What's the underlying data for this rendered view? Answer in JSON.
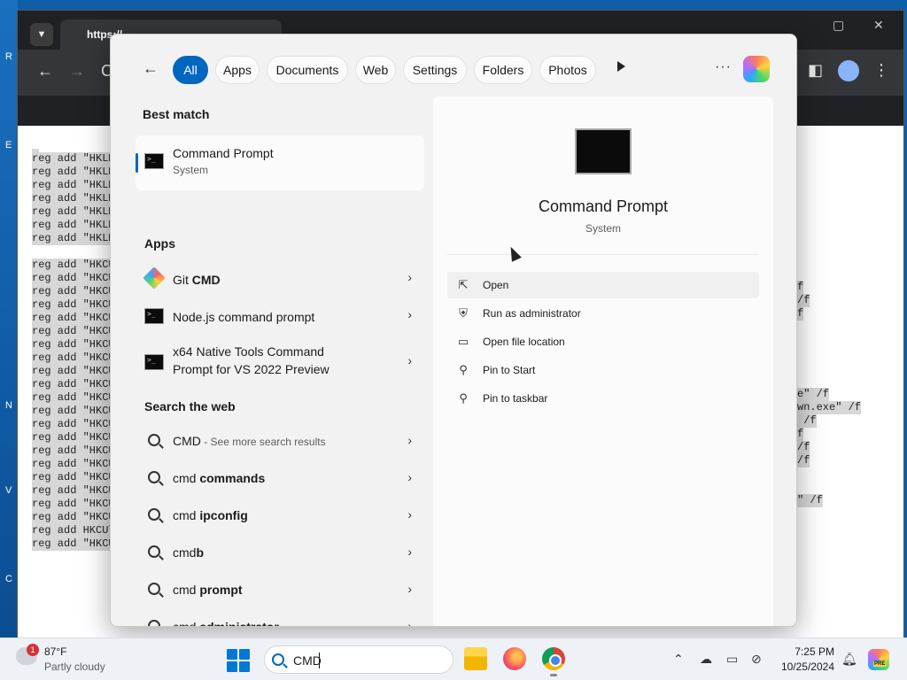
{
  "browser": {
    "tab_title": "https://",
    "code_lines_left": [
      "reg add \"HKLM",
      "reg add \"HKLM",
      "reg add \"HKLM",
      "reg add \"HKLM",
      "reg add \"HKLM",
      "reg add \"HKLM",
      "reg add \"HKLM"
    ],
    "code_lines_left_2": [
      "reg add \"HKCU",
      "reg add \"HKCU",
      "reg add \"HKCU",
      "reg add \"HKCU",
      "reg add \"HKCU",
      "reg add \"HKCU",
      "reg add \"HKCU",
      "reg add \"HKCU",
      "reg add \"HKCU",
      "reg add \"HKCU",
      "reg add \"HKCU",
      "reg add \"HKCU",
      "reg add \"HKCU",
      "reg add \"HKCU",
      "reg add \"HKCU",
      "reg add \"HKCU",
      "reg add \"HKCU",
      "reg add \"HKCU",
      "reg add \"HKCU",
      "reg add \"HKCU",
      "reg add HKCU\\",
      "reg add \"HKCU"
    ],
    "code_fragments_right": [
      "f",
      "/f",
      "f",
      "e\" /f",
      "wn.exe\" /f",
      " /f",
      "f",
      "/f",
      "/f",
      "\" /f"
    ]
  },
  "start_menu": {
    "filters": [
      "All",
      "Apps",
      "Documents",
      "Web",
      "Settings",
      "Folders",
      "Photos"
    ],
    "active_filter": "All",
    "best_match_heading": "Best match",
    "best_match": {
      "title": "Command Prompt",
      "subtitle": "System"
    },
    "apps_heading": "Apps",
    "apps": [
      {
        "label": "Git CMD",
        "bold": "CMD",
        "plain": "Git "
      },
      {
        "label": "Node.js command prompt"
      },
      {
        "label_line1": "x64 Native Tools Command",
        "label_line2": "Prompt for VS 2022 Preview"
      }
    ],
    "web_heading": "Search the web",
    "web_results": [
      {
        "plain": "CMD",
        "bold": "",
        "suffix": " - See more search results"
      },
      {
        "plain": "cmd ",
        "bold": "commands"
      },
      {
        "plain": "cmd ",
        "bold": "ipconfig"
      },
      {
        "plain": "cmd",
        "bold": "b"
      },
      {
        "plain": "cmd ",
        "bold": "prompt"
      },
      {
        "plain": "cmd ",
        "bold": "administrator"
      }
    ],
    "preview": {
      "title": "Command Prompt",
      "subtitle": "System",
      "actions": [
        {
          "label": "Open",
          "icon": "open-external-icon"
        },
        {
          "label": "Run as administrator",
          "icon": "shield-icon"
        },
        {
          "label": "Open file location",
          "icon": "folder-icon"
        },
        {
          "label": "Pin to Start",
          "icon": "pin-icon"
        },
        {
          "label": "Pin to taskbar",
          "icon": "pin-icon"
        }
      ]
    }
  },
  "taskbar": {
    "weather_badge": "1",
    "weather_temp": "87°F",
    "weather_desc": "Partly cloudy",
    "search_value": "CMD",
    "clock_time": "7:25 PM",
    "clock_date": "10/25/2024"
  },
  "colors": {
    "accent": "#0067c0",
    "panel_bg": "#f2f2f2",
    "taskbar_bg": "#eef1f6"
  }
}
